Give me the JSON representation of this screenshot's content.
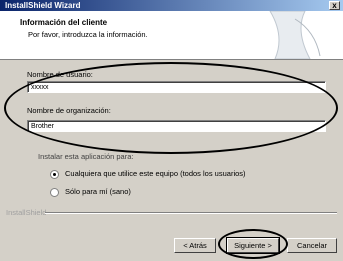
{
  "window": {
    "title": "InstallShield Wizard",
    "close": "x"
  },
  "header": {
    "title": "Información del cliente",
    "subtitle": "Por favor, introduzca la información."
  },
  "form": {
    "username_label": "Nombre de usuario:",
    "username_value": "xxxxx",
    "org_label": "Nombre de organización:",
    "org_value": "Brother",
    "install_for_label": "Instalar esta aplicación para:",
    "option_all": "Cualquiera que utilice este equipo (todos los usuarios)",
    "option_me": "Sólo para mí (sano)",
    "selected_option": "all"
  },
  "footer": {
    "brand": "InstallShield",
    "back": "< Atrás",
    "next": "Siguiente >",
    "cancel": "Cancelar"
  }
}
